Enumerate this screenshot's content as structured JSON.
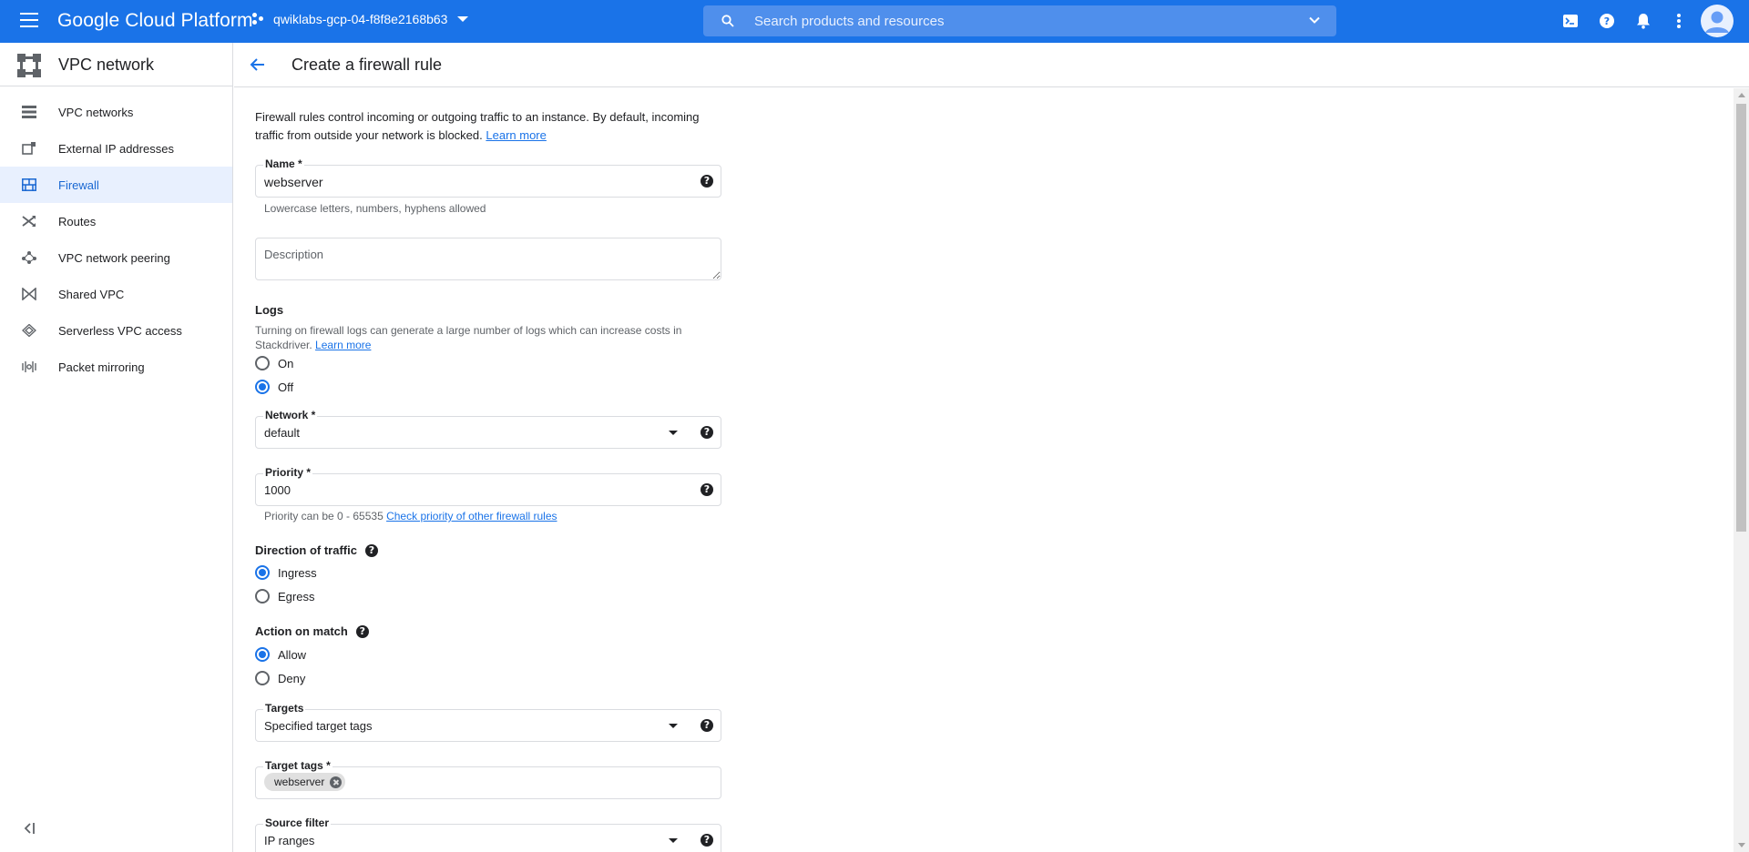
{
  "topbar": {
    "brand": "Google Cloud Platform",
    "project": "qwiklabs-gcp-04-f8f8e2168b63",
    "search_placeholder": "Search products and resources",
    "accent": "#1a73e8"
  },
  "sidebar": {
    "title": "VPC network",
    "items": [
      {
        "label": "VPC networks",
        "icon": "vpc-networks-icon"
      },
      {
        "label": "External IP addresses",
        "icon": "external-ip-icon"
      },
      {
        "label": "Firewall",
        "icon": "firewall-icon",
        "active": true
      },
      {
        "label": "Routes",
        "icon": "routes-icon"
      },
      {
        "label": "VPC network peering",
        "icon": "peering-icon"
      },
      {
        "label": "Shared VPC",
        "icon": "shared-vpc-icon"
      },
      {
        "label": "Serverless VPC access",
        "icon": "serverless-icon"
      },
      {
        "label": "Packet mirroring",
        "icon": "packet-mirroring-icon"
      }
    ]
  },
  "page": {
    "title": "Create a firewall rule",
    "intro": "Firewall rules control incoming or outgoing traffic to an instance. By default, incoming traffic from outside your network is blocked.",
    "intro_link": "Learn more"
  },
  "form": {
    "name": {
      "label": "Name *",
      "value": "webserver",
      "hint": "Lowercase letters, numbers, hyphens allowed"
    },
    "description": {
      "placeholder": "Description"
    },
    "logs": {
      "title": "Logs",
      "text": "Turning on firewall logs can generate a large number of logs which can increase costs in Stackdriver.",
      "link": "Learn more",
      "options": [
        "On",
        "Off"
      ],
      "selected": "Off"
    },
    "network": {
      "label": "Network *",
      "value": "default"
    },
    "priority": {
      "label": "Priority *",
      "value": "1000",
      "hint": "Priority can be 0 - 65535",
      "hint_link": "Check priority of other firewall rules"
    },
    "direction": {
      "title": "Direction of traffic",
      "options": [
        "Ingress",
        "Egress"
      ],
      "selected": "Ingress"
    },
    "action": {
      "title": "Action on match",
      "options": [
        "Allow",
        "Deny"
      ],
      "selected": "Allow"
    },
    "targets": {
      "label": "Targets",
      "value": "Specified target tags"
    },
    "target_tags": {
      "label": "Target tags *",
      "tags": [
        "webserver"
      ]
    },
    "source_filter": {
      "label": "Source filter",
      "value": "IP ranges"
    }
  }
}
